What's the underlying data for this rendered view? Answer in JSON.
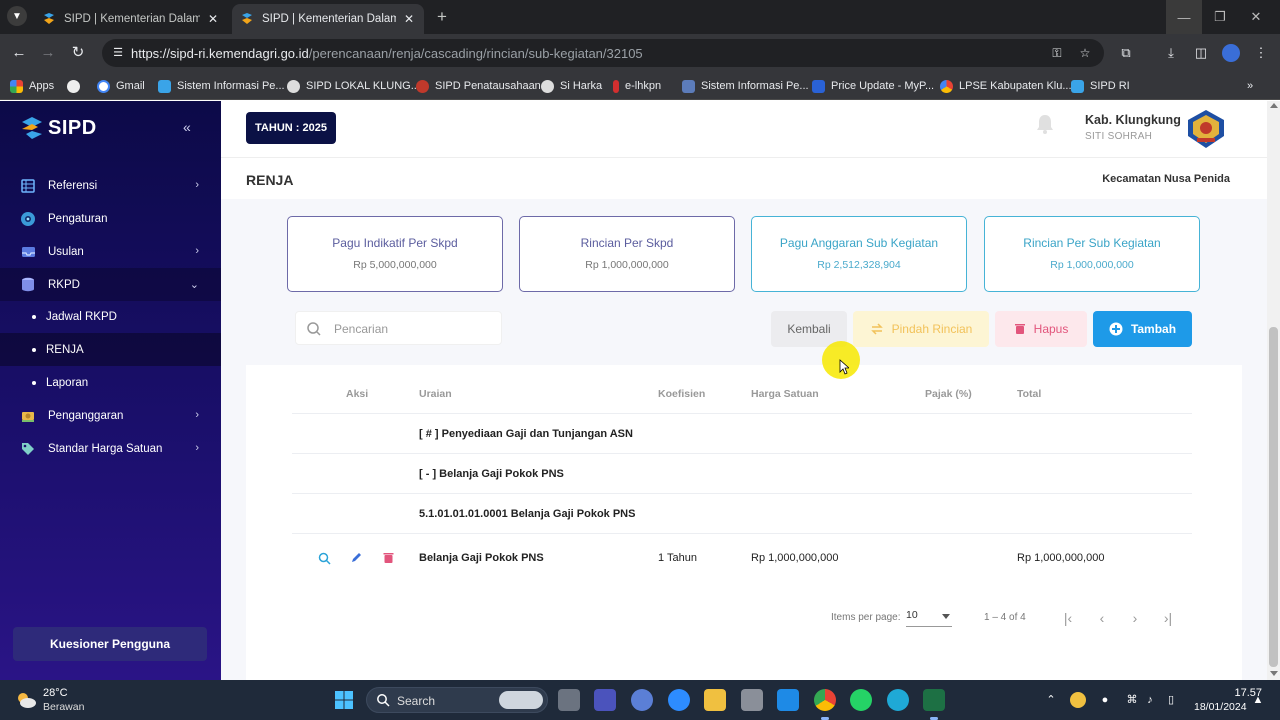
{
  "browser": {
    "tabs": [
      {
        "title": "SIPD | Kementerian Dalam Negeri",
        "active": false
      },
      {
        "title": "SIPD | Kementerian Dalam Negeri",
        "active": true
      }
    ],
    "url_host": "https://sipd-ri.kemendagri.go.id",
    "url_path": "/perencanaan/renja/cascading/rincian/sub-kegiatan/32105",
    "bookmarks": [
      "Apps",
      "Gmail",
      "Sistem Informasi Pe...",
      "SIPD LOKAL KLUNG...",
      "SIPD Penatausahaan",
      "Si Harka",
      "e-lhkpn",
      "Sistem Informasi Pe...",
      "Price Update - MyP...",
      "LPSE Kabupaten Klu...",
      "SIPD RI"
    ]
  },
  "sidebar": {
    "brand": "SIPD",
    "menu": [
      {
        "label": "Referensi",
        "icon": "grid-icon",
        "has_children": true,
        "expanded": false
      },
      {
        "label": "Pengaturan",
        "icon": "gear-icon",
        "has_children": false
      },
      {
        "label": "Usulan",
        "icon": "inbox-icon",
        "has_children": true,
        "expanded": false
      },
      {
        "label": "RKPD",
        "icon": "database-icon",
        "has_children": true,
        "expanded": true
      }
    ],
    "submenu": [
      {
        "label": "Jadwal RKPD",
        "selected": false
      },
      {
        "label": "RENJA",
        "selected": true
      },
      {
        "label": "Laporan",
        "selected": false
      }
    ],
    "menu_bottom": [
      {
        "label": "Penganggaran",
        "icon": "coins-icon"
      },
      {
        "label": "Standar Harga Satuan",
        "icon": "price-tag-icon"
      }
    ],
    "kuesioner_label": "Kuesioner Pengguna"
  },
  "header": {
    "year": "TAHUN : 2025",
    "region": "Kab. Klungkung",
    "user": "SITI SOHRAH",
    "page_title": "RENJA",
    "kecamatan": "Kecamatan Nusa Penida"
  },
  "cards": [
    {
      "title": "Pagu Indikatif Per Skpd",
      "value": "Rp 5,000,000,000",
      "accent": "#6d6aa8"
    },
    {
      "title": "Rincian Per Skpd",
      "value": "Rp 1,000,000,000",
      "accent": "#6d6aa8"
    },
    {
      "title": "Pagu Anggaran Sub Kegiatan",
      "value": "Rp 2,512,328,904",
      "accent": "#46b3d6"
    },
    {
      "title": "Rincian Per Sub Kegiatan",
      "value": "Rp 1,000,000,000",
      "accent": "#46b3d6"
    }
  ],
  "actions": {
    "search_placeholder": "Pencarian",
    "kembali": "Kembali",
    "pindah": "Pindah Rincian",
    "hapus": "Hapus",
    "tambah": "Tambah"
  },
  "table": {
    "headers": [
      "Aksi",
      "Uraian",
      "Koefisien",
      "Harga Satuan",
      "Pajak (%)",
      "Total"
    ],
    "group_rows": [
      "[ # ] Penyediaan Gaji dan Tunjangan ASN",
      "[ - ] Belanja Gaji Pokok PNS",
      "5.1.01.01.01.0001 Belanja Gaji Pokok PNS"
    ],
    "item_row": {
      "uraian": "Belanja Gaji Pokok PNS",
      "koefisien": "1 Tahun",
      "harga_satuan": "Rp 1,000,000,000",
      "pajak": "",
      "total": "Rp 1,000,000,000"
    }
  },
  "pagination": {
    "items_per_page_label": "Items per page:",
    "items_per_page": "10",
    "range": "1 – 4 of 4"
  },
  "taskbar": {
    "temperature": "28°C",
    "condition": "Berawan",
    "search_label": "Search",
    "time": "17.57",
    "date": "18/01/2024"
  },
  "colors": {
    "sidebar": "#1a0f6b",
    "primary": "#1e9ae8",
    "danger": "#e2557c",
    "warning": "#f2c25a"
  }
}
